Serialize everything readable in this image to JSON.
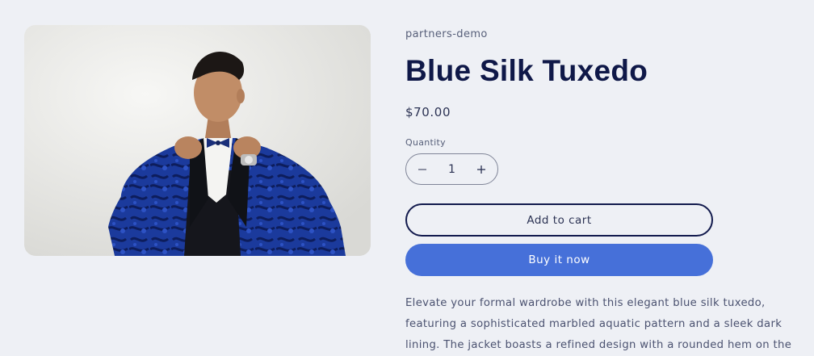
{
  "product": {
    "vendor": "partners-demo",
    "title": "Blue Silk Tuxedo",
    "price": "$70.00",
    "image_subject": "man in blue silk tuxedo adjusting bow tie"
  },
  "quantity": {
    "label": "Quantity",
    "value": "1",
    "decrease_icon": "minus-icon",
    "increase_icon": "plus-icon"
  },
  "actions": {
    "add_to_cart": "Add to cart",
    "buy_now": "Buy it now"
  },
  "description": {
    "lines": [
      "Elevate your formal wardrobe with this elegant blue silk tuxedo,",
      "featuring a sophisticated marbled aquatic pattern and a sleek dark",
      "lining. The jacket boasts a refined design with a rounded hem on the"
    ]
  },
  "colors": {
    "background": "#eef0f5",
    "heading": "#0f1848",
    "accent": "#4670d9",
    "outline": "#121a4d"
  }
}
